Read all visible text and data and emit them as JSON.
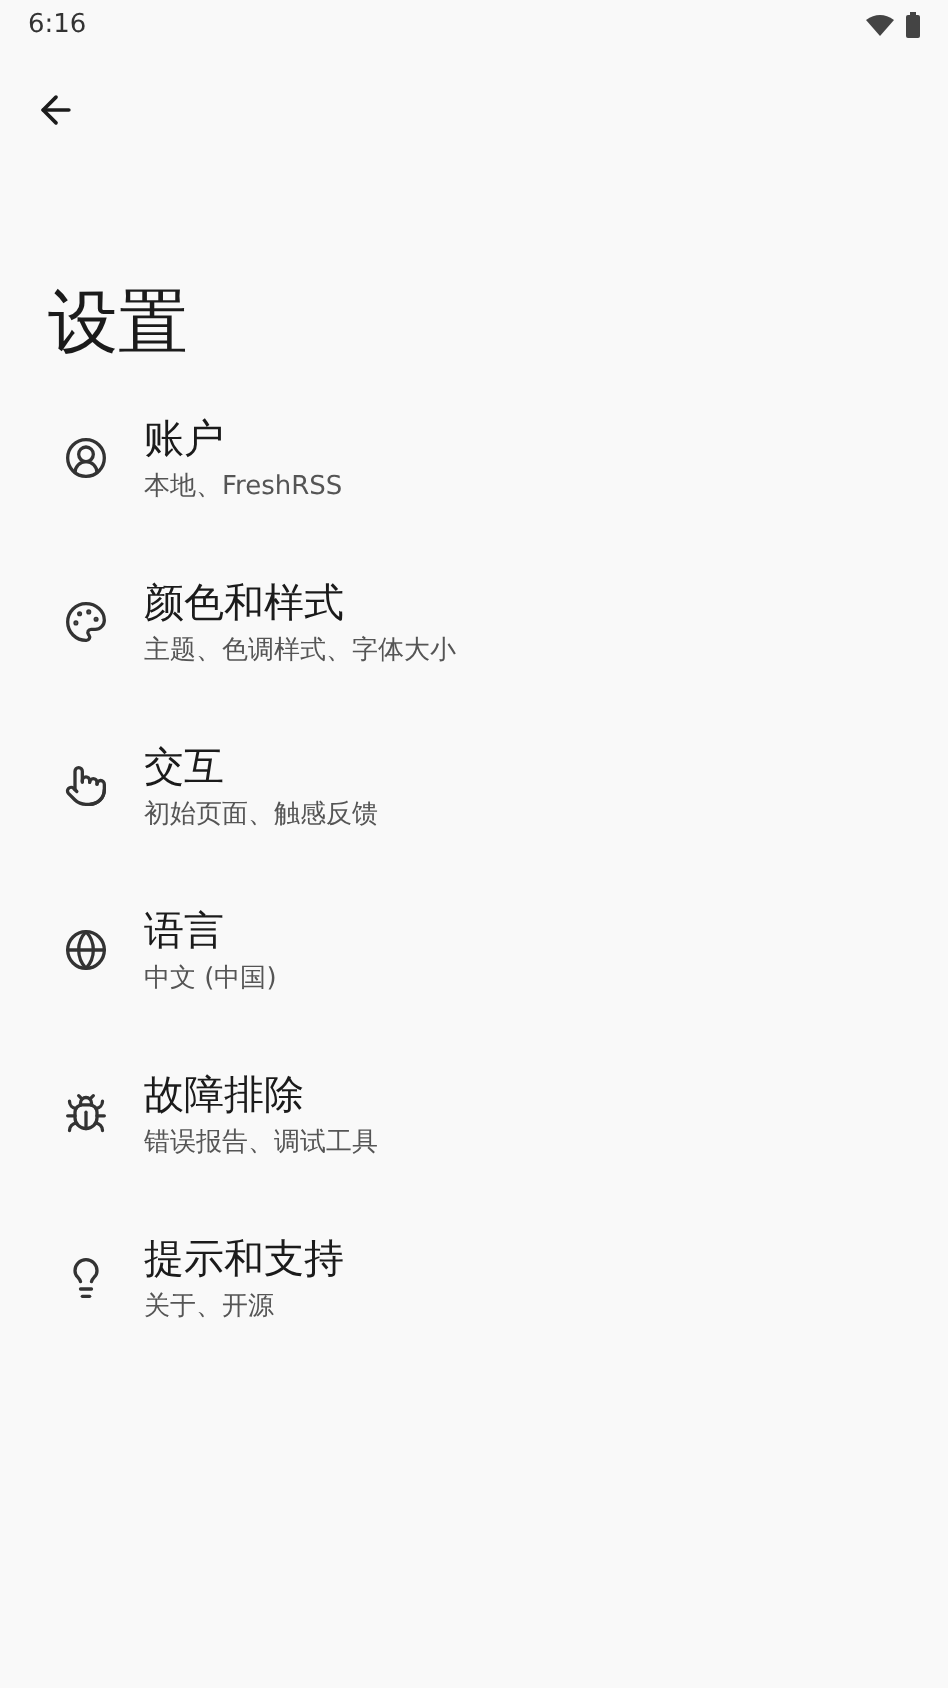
{
  "status_bar": {
    "time": "6:16"
  },
  "title": "设置",
  "items": [
    {
      "kind": "account",
      "title": "账户",
      "subtitle": "本地、FreshRSS"
    },
    {
      "kind": "palette",
      "title": "颜色和样式",
      "subtitle": "主题、色调样式、字体大小"
    },
    {
      "kind": "touch",
      "title": "交互",
      "subtitle": "初始页面、触感反馈"
    },
    {
      "kind": "language",
      "title": "语言",
      "subtitle": "中文 (中国)"
    },
    {
      "kind": "bug",
      "title": "故障排除",
      "subtitle": "错误报告、调试工具"
    },
    {
      "kind": "tips",
      "title": "提示和支持",
      "subtitle": "关于、开源"
    }
  ]
}
